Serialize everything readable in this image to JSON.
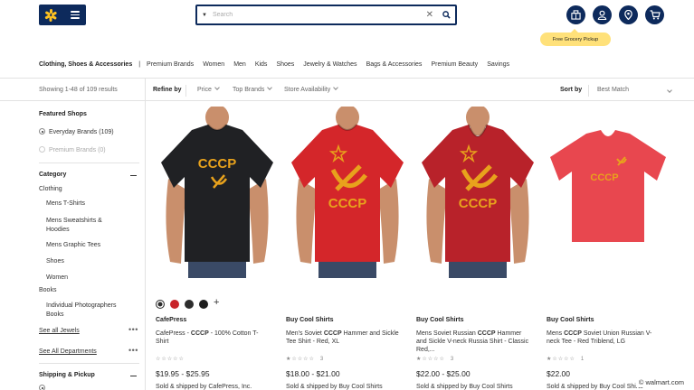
{
  "header": {
    "search_placeholder": "Search",
    "search_value": "",
    "tooltip": "Free Grocery Pickup",
    "icons": [
      "walmart-spark-logo",
      "menu-icon",
      "search-dept-caret",
      "clear-icon",
      "search-icon",
      "reorder-icon",
      "account-icon",
      "store-locator-icon",
      "cart-icon"
    ]
  },
  "nav": {
    "items": [
      "Clothing, Shoes & Accessories",
      "Premium Brands",
      "Women",
      "Men",
      "Kids",
      "Shoes",
      "Jewelry & Watches",
      "Bags & Accessories",
      "Premium Beauty",
      "Savings"
    ]
  },
  "filters": {
    "results": "Showing 1-48 of 109 results",
    "refine_label": "Refine by",
    "price": "Price",
    "top_brands": "Top Brands",
    "store_availability": "Store Availability",
    "sort_label": "Sort by",
    "sort_value": "Best Match"
  },
  "sidebar": {
    "featured_title": "Featured Shops",
    "featured": [
      {
        "label": "Everyday Brands (109)",
        "selected": true
      },
      {
        "label": "Premium Brands (0)",
        "selected": false
      }
    ],
    "category_title": "Category",
    "categories": [
      "Clothing",
      "Mens T-Shirts",
      "Mens Sweatshirts & Hoodies",
      "Mens Graphic Tees",
      "Shoes",
      "Women",
      "Books",
      "Individual Photographers Books"
    ],
    "see_all_jewels": "See all Jewels",
    "see_all_departments": "See All Departments",
    "shipping_title": "Shipping & Pickup"
  },
  "products": [
    {
      "brand": "CafePress",
      "title_pre": "CafePress - ",
      "title_bold": "CCCP",
      "title_post": " - 100% Cotton T-Shirt",
      "stars": "☆☆☆☆☆",
      "reviews": "",
      "price": "$19.95 - $25.95",
      "seller": "Sold & shipped by CafePress, Inc.",
      "shirt_color": "#202124",
      "print_text": "CCCP",
      "swatches": [
        "#2d2d2d",
        "#c8242a",
        "#2d2d2d",
        "#1d1d1d"
      ],
      "more_swatches": "+"
    },
    {
      "brand": "Buy Cool Shirts",
      "title_pre": "Men's Soviet ",
      "title_bold": "CCCP",
      "title_post": " Hammer and Sickle Tee Shirt - Red, XL",
      "stars": "★☆☆☆☆",
      "reviews": "3",
      "price": "$18.00 - $21.00",
      "seller": "Sold & shipped by Buy Cool Shirts",
      "shirt_color": "#d4262a",
      "print_text": "CCCP"
    },
    {
      "brand": "Buy Cool Shirts",
      "title_pre": "Mens Soviet Russian ",
      "title_bold": "CCCP",
      "title_post": " Hammer and Sickle V-neck Russia Shirt - Classic Red,...",
      "stars": "★☆☆☆☆",
      "reviews": "3",
      "price": "$22.00 - $25.00",
      "seller": "Sold & shipped by Buy Cool Shirts",
      "shirt_color": "#b8222a",
      "print_text": "CCCP"
    },
    {
      "brand": "Buy Cool Shirts",
      "title_pre": "Mens ",
      "title_bold": "CCCP",
      "title_post": " Soviet Union Russian V-neck Tee - Red Triblend, LG",
      "stars": "★☆☆☆☆",
      "reviews": "1",
      "price": "$22.00",
      "seller": "Sold & shipped by Buy Cool Shirts",
      "shirt_color": "#e8474f",
      "print_text": "CCCP"
    }
  ],
  "watermark": "© walmart.com",
  "colors": {
    "navy": "#0d2a5c",
    "spark": "#ffc220",
    "tooltip": "#ffe17a",
    "print_gold": "#e8a21c"
  }
}
